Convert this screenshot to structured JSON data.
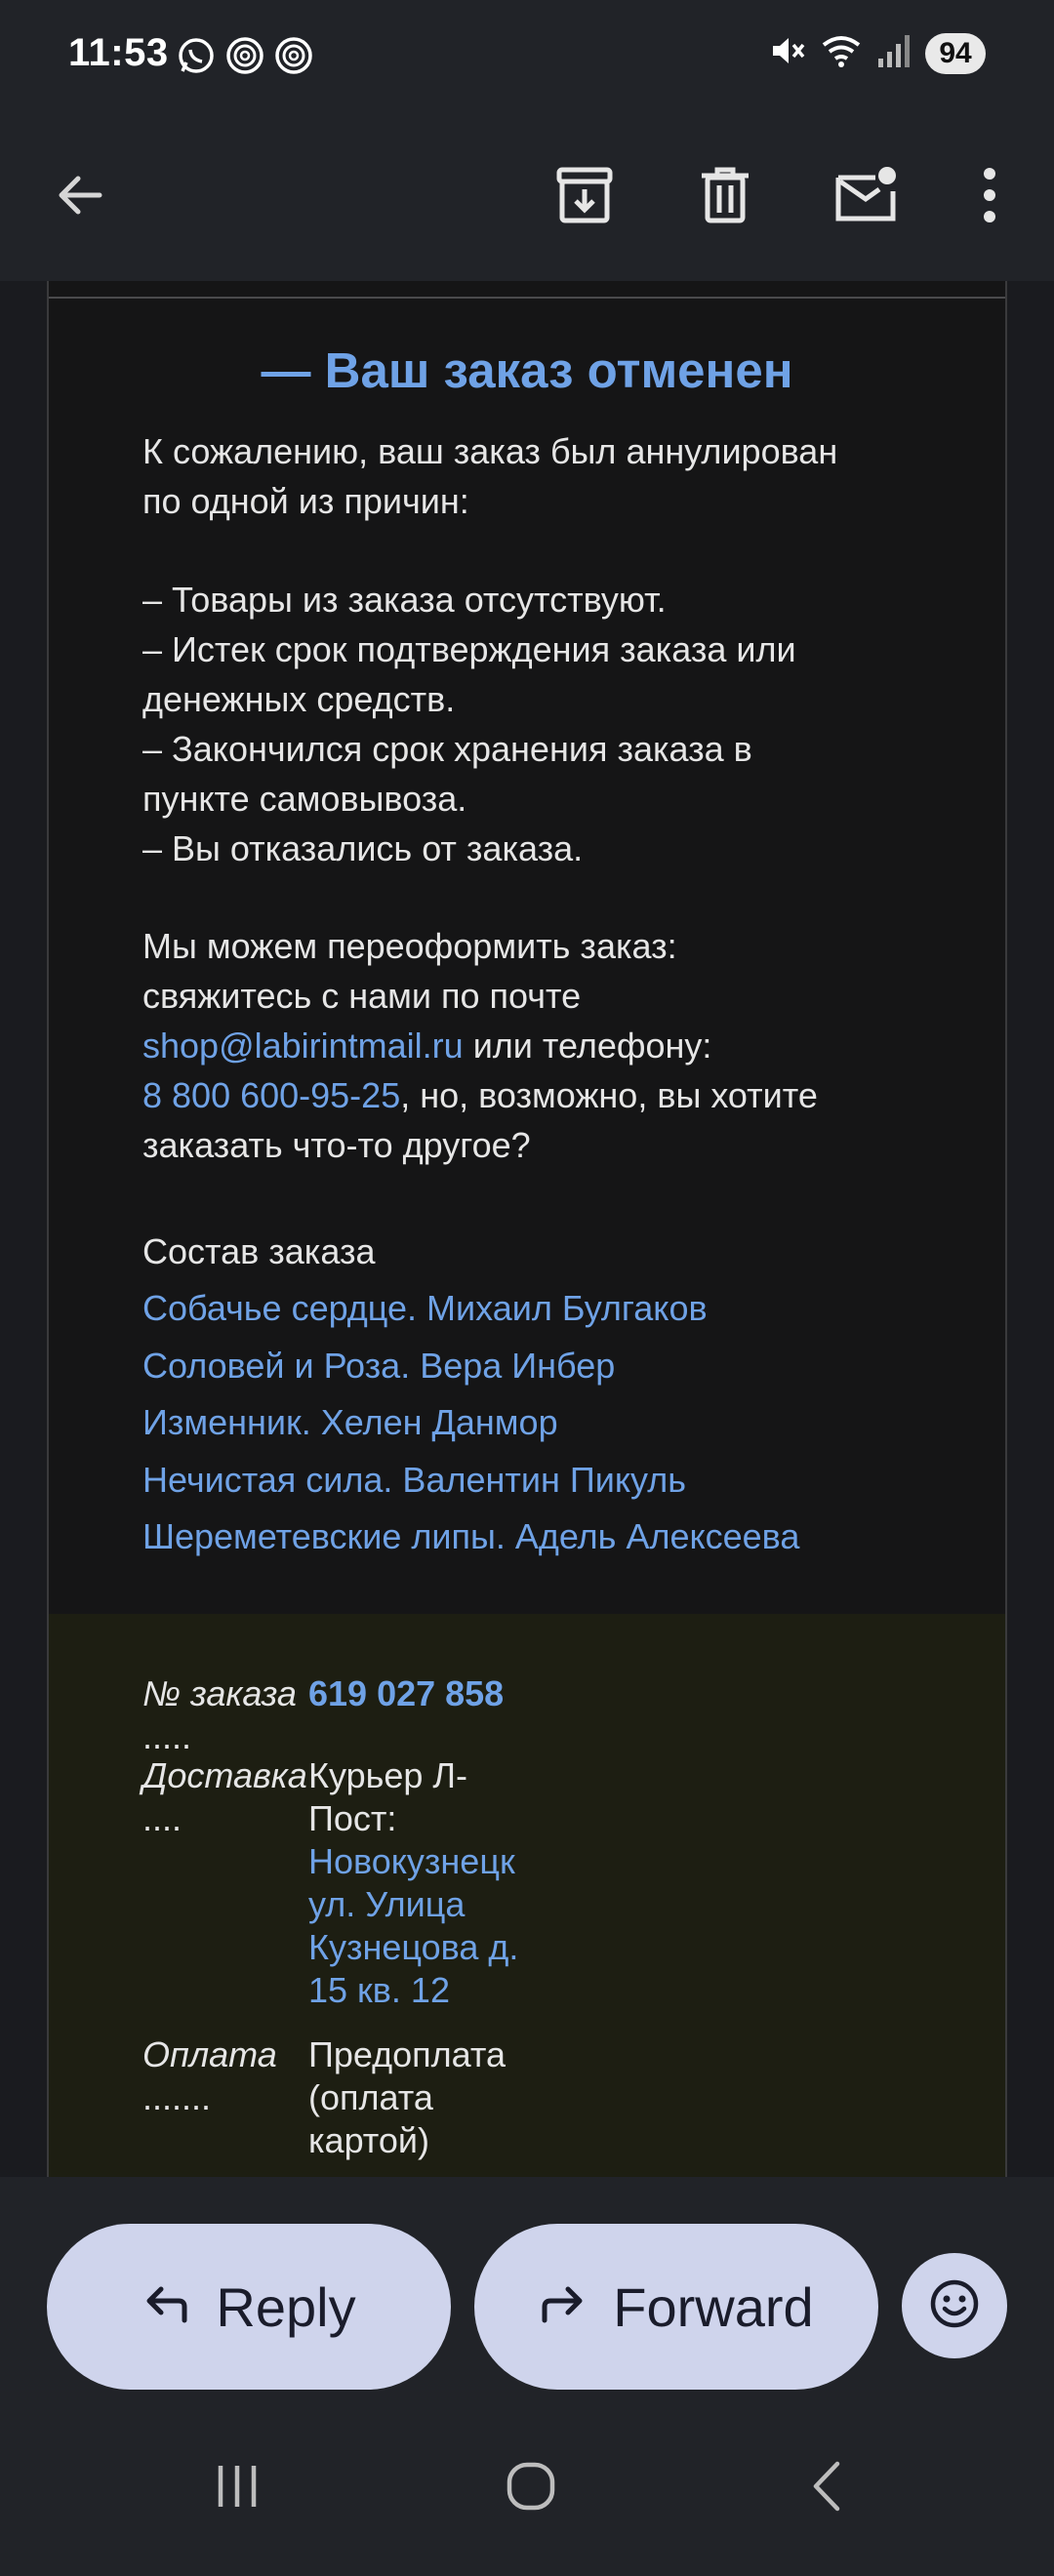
{
  "status_bar": {
    "time": "11:53",
    "battery": "94",
    "left_icons": [
      "whatsapp-icon",
      "threads-icon",
      "threads-icon"
    ],
    "right_icons": [
      "mute-icon",
      "wifi-icon",
      "signal-icon"
    ]
  },
  "app_bar": {
    "icons": [
      "back-arrow-icon",
      "archive-icon",
      "delete-icon",
      "mark-unread-icon",
      "more-vert-icon"
    ]
  },
  "email": {
    "title": "— Ваш заказ отменен",
    "intro_line1": "К сожалению, ваш заказ был аннулирован",
    "intro_line2": "по одной из причин:",
    "reasons": [
      "– Товары из заказа отсутствуют.",
      "– Истек срок подтверждения заказа или",
      "денежных средств.",
      "– Закончился срок хранения заказа в",
      "пункте самовывоза.",
      "– Вы отказались от заказа."
    ],
    "contact_line1": "Мы можем переоформить заказ:",
    "contact_line2": "свяжитесь с нами по почте",
    "email_link": "shop@labirintmail.ru",
    "contact_phone_prefix": " или телефону:",
    "phone_link": "8 800 600-95-25",
    "contact_after_phone": ", но, возможно, вы хотите",
    "contact_last": "заказать что-то другое?",
    "order_heading": "Состав заказа",
    "order_items": [
      "Собачье сердце. Михаил Булгаков",
      "Соловей и Роза. Вера Инбер",
      "Изменник. Хелен Данмор",
      "Нечистая сила. Валентин Пикуль",
      "Шереметевские липы. Адель Алексеева"
    ],
    "details": {
      "order_label": "№ заказа",
      "order_dots": ".....",
      "order_number": "619 027 858",
      "delivery_label": "Доставка",
      "delivery_dots": "....",
      "delivery_line1": "Курьер Л-",
      "delivery_line2": "Пост:",
      "address_line1": "Новокузнецк",
      "address_line2": "ул. Улица",
      "address_line3": "Кузнецова д.",
      "address_line4": "15 кв. 12",
      "payment_label": "Оплата",
      "payment_dots": ".......",
      "payment_line1": "Предоплата",
      "payment_line2": "(оплата",
      "payment_line3": "картой)"
    }
  },
  "actions": {
    "reply_label": "Reply",
    "forward_label": "Forward",
    "reply_icon": "reply-icon",
    "forward_icon": "forward-icon",
    "emoji_icon": "emoji-icon"
  },
  "nav": {
    "icons": [
      "recent-apps-icon",
      "home-icon",
      "back-icon"
    ]
  }
}
